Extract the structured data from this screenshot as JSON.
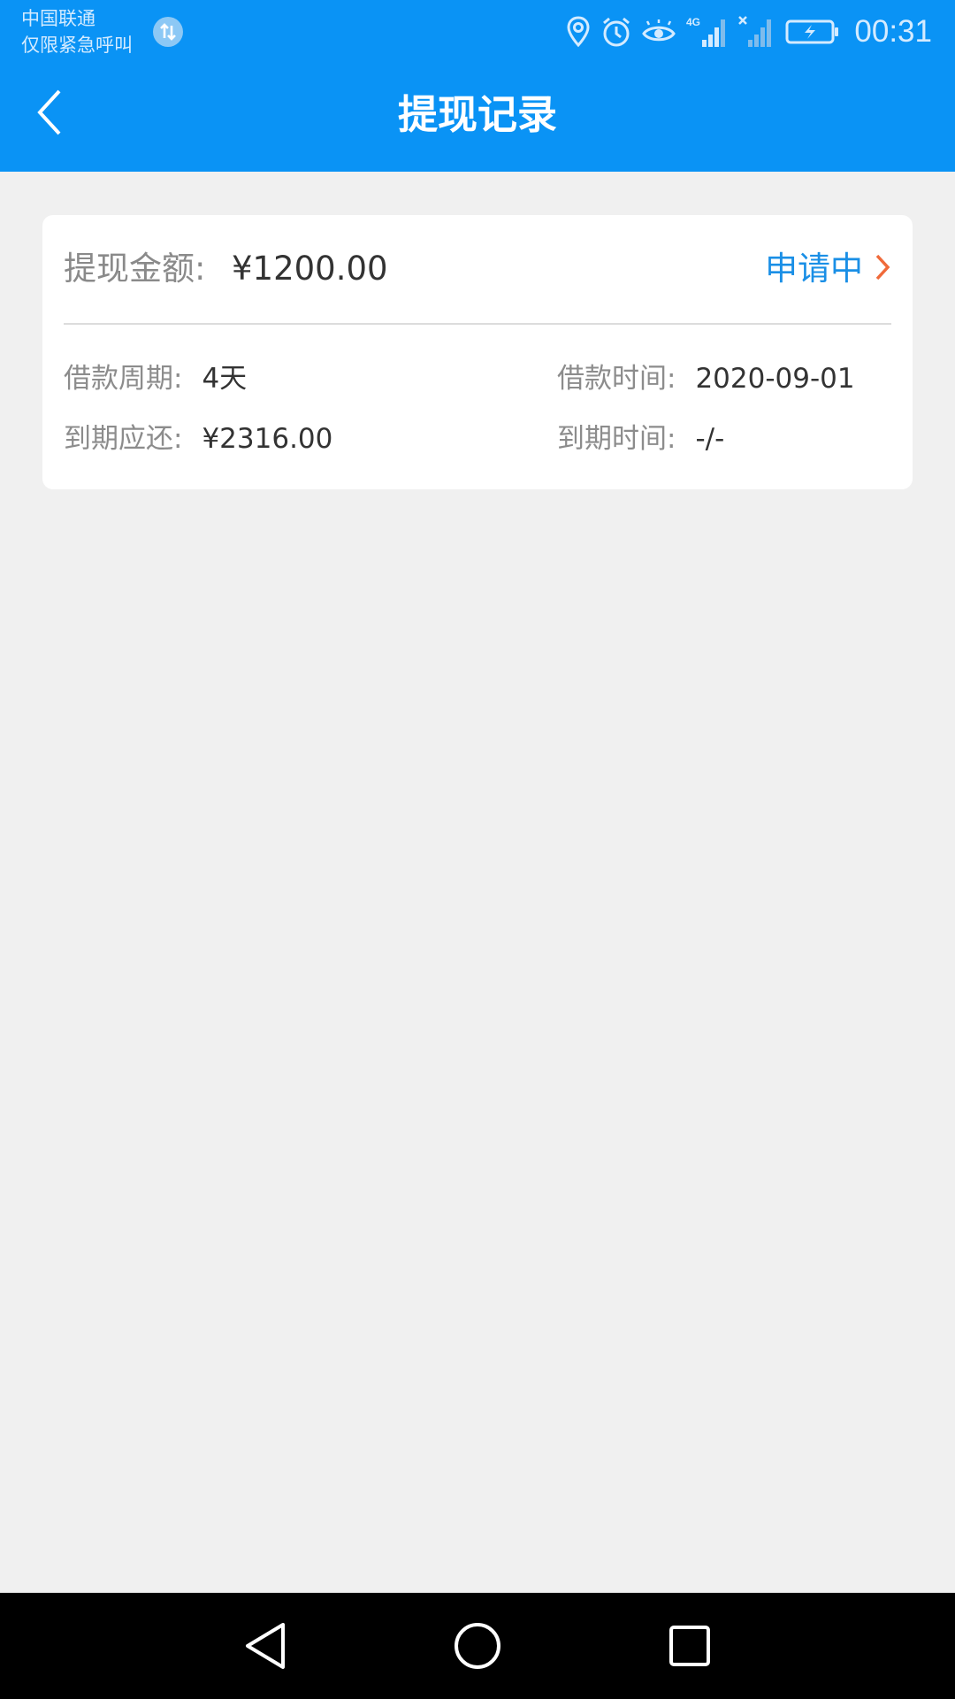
{
  "status_bar": {
    "carrier_line1": "中国联通",
    "carrier_line2": "仅限紧急呼叫",
    "network_type": "4G",
    "time": "00:31",
    "icons": [
      "data-transfer-icon",
      "location-icon",
      "alarm-icon",
      "eye-comfort-icon",
      "signal-4g-icon",
      "signal-none-icon",
      "battery-charging-icon"
    ]
  },
  "header": {
    "title": "提现记录",
    "back_icon": "back-chevron-icon"
  },
  "record": {
    "amount_label": "提现金额:",
    "amount_value": "¥1200.00",
    "status": "申请中",
    "status_icon": "chevron-right-icon",
    "period_label": "借款周期:",
    "period_value": "4天",
    "loan_time_label": "借款时间:",
    "loan_time_value": "2020-09-01",
    "due_amount_label": "到期应还:",
    "due_amount_value": "¥2316.00",
    "due_time_label": "到期时间:",
    "due_time_value": "-/-"
  },
  "nav_bar": {
    "icons": [
      "nav-back-icon",
      "nav-home-icon",
      "nav-recents-icon"
    ]
  },
  "colors": {
    "brand_blue": "#0a93f5",
    "status_blue": "#1a8fe6",
    "chevron_orange": "#f06a3a",
    "background": "#f0f0f0"
  }
}
